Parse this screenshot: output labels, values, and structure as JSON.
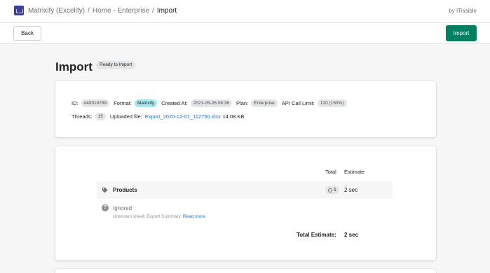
{
  "breadcrumb": {
    "app": "Matrixify (Excelify)",
    "sep1": "/",
    "store": "Home - Enterprise",
    "sep2": "/",
    "current": "Import"
  },
  "byline": "by ITissible",
  "actions": {
    "back_label": "Back",
    "import_label": "Import"
  },
  "page": {
    "title": "Import",
    "status": "Ready to Import"
  },
  "info": {
    "id_label": "ID:",
    "id_value": "#49318789",
    "format_label": "Format:",
    "format_value": "Matrixify",
    "created_label": "Created At:",
    "created_value": "2021-05-26 08:36",
    "plan_label": "Plan:",
    "plan_value": "Enterprise",
    "api_label": "API Call Limit:",
    "api_value": "120 (150%)",
    "threads_label": "Threads:",
    "threads_value": "15",
    "file_label": "Uploaded file:",
    "file_name": "Export_2020-12-01_112750.xlsx",
    "file_size": "14.08 KB"
  },
  "summary": {
    "col_total": "Total",
    "col_estimate": "Estimate",
    "rows": [
      {
        "name": "Products",
        "total": "1",
        "estimate": "2 sec",
        "icon": "tag-icon"
      }
    ],
    "ignored_label": "Ignored",
    "ignored_note": "Unknown sheet: Export Summary",
    "read_more": "Read more",
    "total_label": "Total Estimate:",
    "total_value": "2 sec"
  },
  "colors": {
    "primary": "#008060",
    "link": "#2c6ecb",
    "badge_blue": "#a4e8f2",
    "badge_gray": "#e4e5e7"
  }
}
